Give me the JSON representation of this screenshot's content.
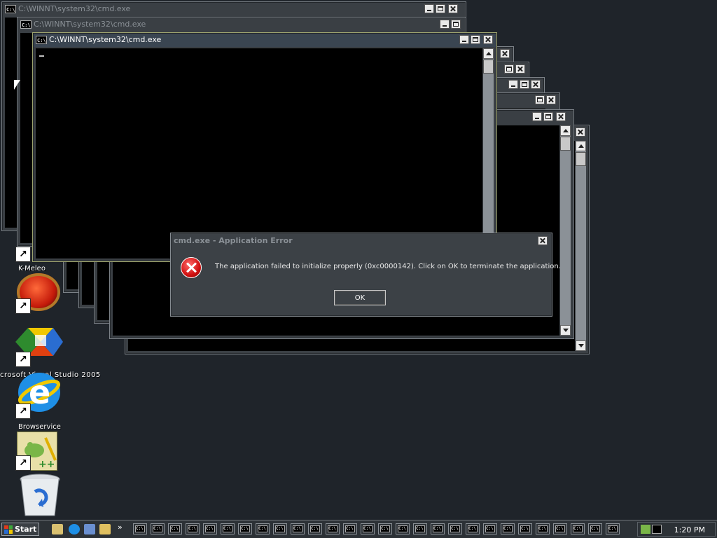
{
  "windows": {
    "title": "C:\\WINNT\\system32\\cmd.exe",
    "icon_label": "C:\\"
  },
  "desktop_icons": [
    {
      "name": "kmeleon",
      "label": "K-Meleo"
    },
    {
      "name": "visual-studio",
      "label": "crosoft Visual Studio 2005"
    },
    {
      "name": "browservice",
      "label": "Browservice"
    }
  ],
  "dialog": {
    "title": "cmd.exe - Application Error",
    "message": "The application failed to initialize properly (0xc0000142). Click on OK to terminate the application.",
    "ok_label": "OK"
  },
  "taskbar": {
    "start_label": "Start",
    "chevron": "»",
    "clock": "1:20 PM",
    "task_icon_label": "C:\\"
  },
  "colors": {
    "desktop": "#1f242a",
    "window_frame": "#3a3f44",
    "console_bg": "#000000",
    "error_red": "#d01010"
  }
}
